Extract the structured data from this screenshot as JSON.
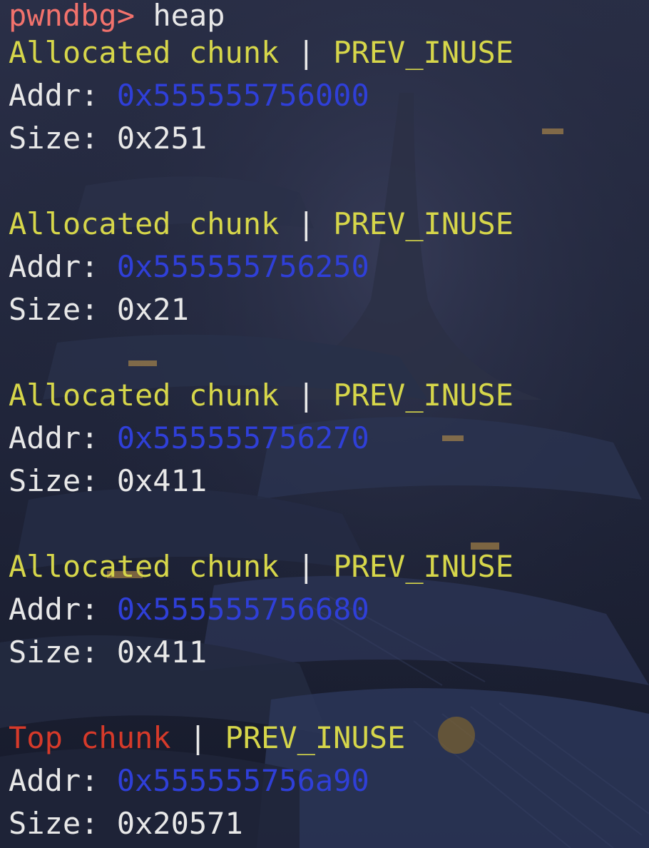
{
  "prompt": {
    "name": "pwndbg>",
    "command": "heap"
  },
  "separator": "|",
  "labels": {
    "addr": "Addr:",
    "size": "Size:"
  },
  "chunks": [
    {
      "type": "Allocated chunk",
      "flag": "PREV_INUSE",
      "addr": "0x555555756000",
      "size": "0x251"
    },
    {
      "type": "Allocated chunk",
      "flag": "PREV_INUSE",
      "addr": "0x555555756250",
      "size": "0x21"
    },
    {
      "type": "Allocated chunk",
      "flag": "PREV_INUSE",
      "addr": "0x555555756270",
      "size": "0x411"
    },
    {
      "type": "Allocated chunk",
      "flag": "PREV_INUSE",
      "addr": "0x555555756680",
      "size": "0x411"
    },
    {
      "type": "Top chunk",
      "flag": "PREV_INUSE",
      "addr": "0x555555756a90",
      "size": "0x20571"
    }
  ],
  "colors": {
    "prompt": "#f2726c",
    "allocated": "#d6d64a",
    "top": "#d63a2a",
    "address": "#2f3fd8",
    "text": "#e8e8e8"
  }
}
